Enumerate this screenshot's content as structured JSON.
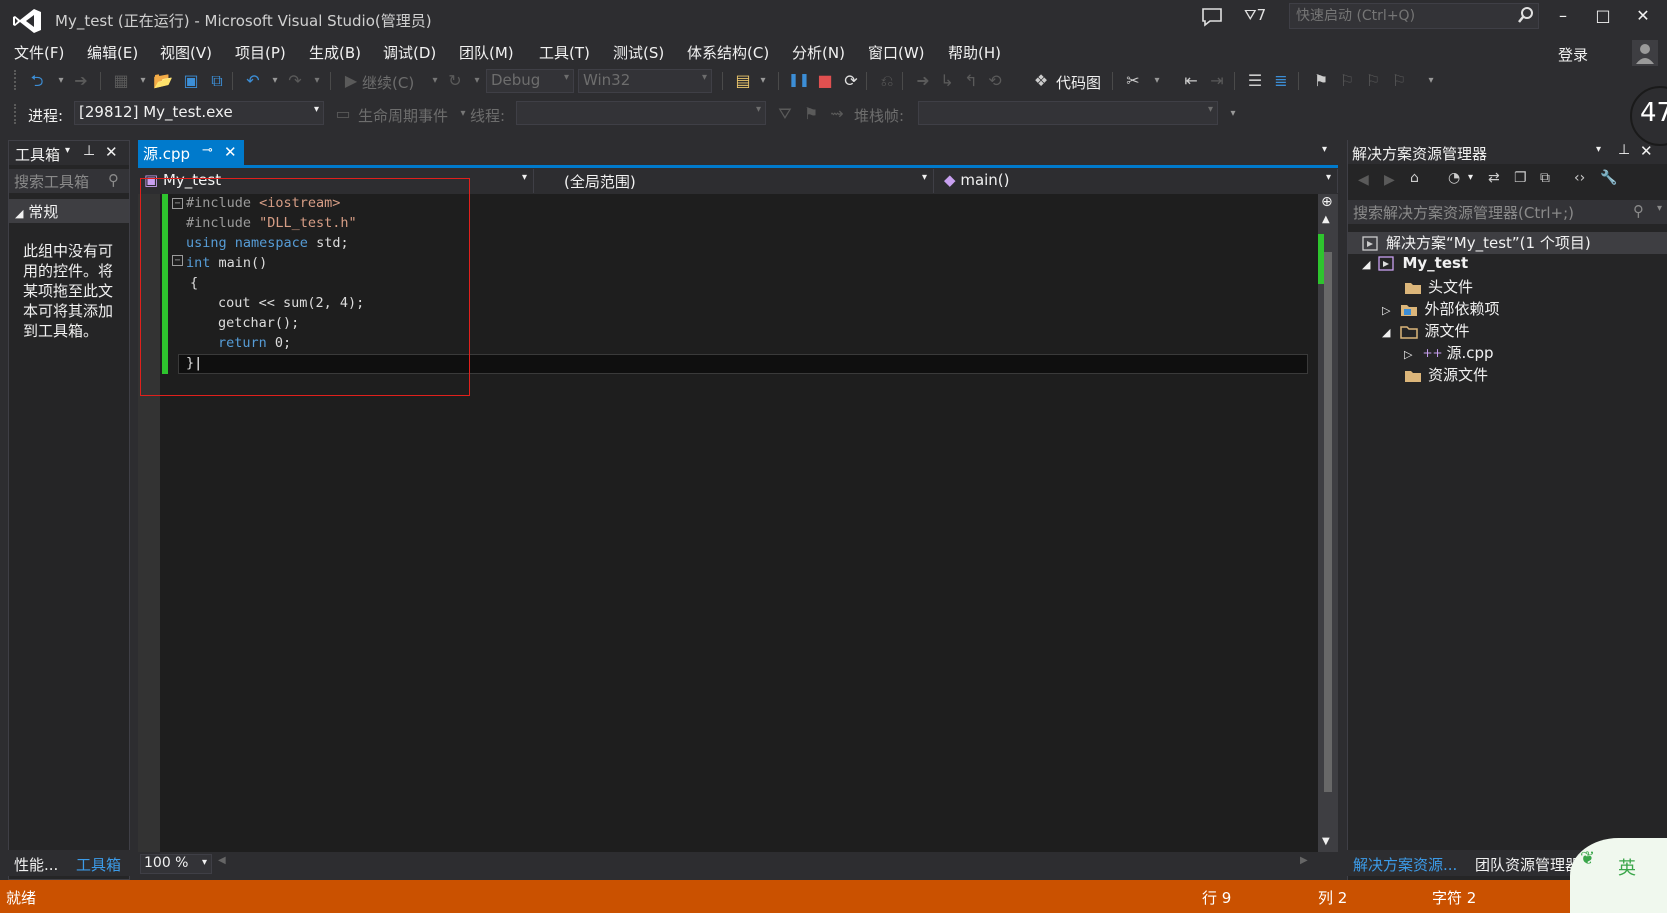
{
  "window": {
    "title": "My_test (正在运行) - Microsoft Visual Studio(管理员)",
    "notification_count": "7",
    "quick_launch_placeholder": "快速启动 (Ctrl+Q)",
    "login": "登录",
    "clock_partial": "47"
  },
  "menu": [
    "文件(F)",
    "编辑(E)",
    "视图(V)",
    "项目(P)",
    "生成(B)",
    "调试(D)",
    "团队(M)",
    "工具(T)",
    "测试(S)",
    "体系结构(C)",
    "分析(N)",
    "窗口(W)",
    "帮助(H)"
  ],
  "toolbar": {
    "continue": "继续(C)",
    "config": "Debug",
    "platform": "Win32",
    "codemap": "代码图",
    "process_label": "进程:",
    "process_value": "[29812] My_test.exe",
    "lifecycle": "生命周期事件",
    "thread_label": "线程:",
    "stack_label": "堆栈帧:"
  },
  "toolbox": {
    "title": "工具箱",
    "search_placeholder": "搜索工具箱",
    "group": "常规",
    "empty_message": "此组中没有可用的控件。将某项拖至此文本可将其添加到工具箱。",
    "bottom_tabs": [
      "性能...",
      "工具箱"
    ]
  },
  "editor": {
    "tab": "源.cpp",
    "project_combo": "My_test",
    "scope_combo": "(全局范围)",
    "member_combo": "main()",
    "zoom": "100 %",
    "lines": [
      {
        "pp": "#include ",
        "str": "<iostream>"
      },
      {
        "pp": "#include ",
        "str": "\"DLL_test.h\""
      },
      {
        "kw1": "using",
        "kw2": "namespace",
        "rest": "std;"
      },
      {
        "kw": "int",
        "rest": "main()"
      },
      {
        "rest": "{"
      },
      {
        "rest": "cout << sum(2, 4);"
      },
      {
        "rest": "getchar();"
      },
      {
        "kw": "return",
        "rest": "0;"
      },
      {
        "rest": "}"
      }
    ]
  },
  "solution": {
    "title": "解决方案资源管理器",
    "search_placeholder": "搜索解决方案资源管理器(Ctrl+;)",
    "root": "解决方案“My_test”(1 个项目)",
    "project": "My_test",
    "header_files": "头文件",
    "external_deps": "外部依赖项",
    "source_files": "源文件",
    "source_cpp": "源.cpp",
    "resource_files": "资源文件",
    "bottom_tabs": [
      "解决方案资源...",
      "团队资源管理器"
    ]
  },
  "status": {
    "ready": "就绪",
    "line": "行 9",
    "col": "列 2",
    "char": "字符 2"
  },
  "ime": {
    "mode": "英"
  },
  "colors": {
    "accent": "#007acc",
    "status": "#ca5100",
    "keyword": "#569cd6",
    "string": "#d69d85",
    "highlight": "#e0201c"
  }
}
